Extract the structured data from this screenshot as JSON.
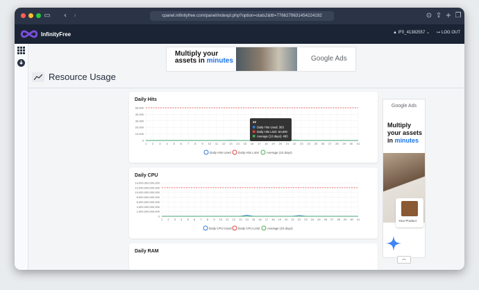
{
  "browser": {
    "url": "cpanel.infinityfree.com/panel/indexpl.php?option=stats2&ttt=7766279631454224192"
  },
  "app": {
    "brand": "InfinityFree",
    "user_label": "IF0_41382557",
    "logout_label": "LOG OUT"
  },
  "top_ad": {
    "line1": "Multiply your",
    "line2_prefix": "assets in ",
    "line2_highlight": "minutes",
    "brand": "Google Ads"
  },
  "page": {
    "title": "Resource Usage"
  },
  "side_ad": {
    "brand": "Google Ads",
    "line1": "Multiply",
    "line2": "your assets",
    "line3_prefix": "in ",
    "line3_highlight": "minutes",
    "product_label": "Your Product"
  },
  "colors": {
    "accent_blue": "#2f7bd9",
    "limit_red": "#e0413c",
    "average_green": "#4caf50",
    "brand_purple": "#6c3fd6",
    "appbar": "#1a2434"
  },
  "chart_data": [
    {
      "type": "line",
      "title": "Daily Hits",
      "x": [
        1,
        2,
        3,
        4,
        5,
        6,
        7,
        8,
        9,
        10,
        11,
        12,
        13,
        14,
        15,
        16,
        17,
        18,
        19,
        20,
        21,
        22,
        23,
        24,
        25,
        26,
        27,
        28,
        29,
        30,
        31
      ],
      "ylim": [
        0,
        50000
      ],
      "yticks": [
        "50,000",
        "40,000",
        "30,000",
        "20,000",
        "10,000",
        "0"
      ],
      "series": [
        {
          "name": "Daily Hits Used",
          "color": "#2f7bd9",
          "values": [
            0,
            0,
            0,
            0,
            0,
            0,
            0,
            0,
            0,
            0,
            0,
            0,
            363,
            0,
            0,
            0,
            0,
            0,
            0,
            0,
            0,
            363,
            0,
            0,
            0,
            0,
            0,
            0,
            0,
            0,
            0
          ]
        },
        {
          "name": "Daily Hits Limit",
          "color": "#e0413c",
          "values": [
            50000,
            50000,
            50000,
            50000,
            50000,
            50000,
            50000,
            50000,
            50000,
            50000,
            50000,
            50000,
            50000,
            50000,
            50000,
            50000,
            50000,
            50000,
            50000,
            50000,
            50000,
            50000,
            50000,
            50000,
            50000,
            50000,
            50000,
            50000,
            50000,
            50000,
            50000
          ]
        },
        {
          "name": "Average (10 days)",
          "color": "#4caf50",
          "values": [
            0,
            0,
            0,
            0,
            0,
            0,
            0,
            0,
            0,
            0,
            0,
            0,
            0,
            0,
            0,
            0,
            0,
            0,
            0,
            0,
            0,
            480,
            0,
            0,
            0,
            0,
            0,
            0,
            0,
            0,
            0
          ]
        }
      ],
      "tooltip": {
        "title": "22",
        "lines": [
          "Daily Hits Used: 363",
          "Daily Hits Limit: 50,000",
          "Average (10 days): 480"
        ]
      }
    },
    {
      "type": "line",
      "title": "Daily CPU",
      "x": [
        1,
        2,
        3,
        4,
        5,
        6,
        7,
        8,
        9,
        10,
        11,
        12,
        13,
        14,
        15,
        16,
        17,
        18,
        19,
        20,
        21,
        22,
        23,
        24,
        25,
        26,
        27,
        28,
        29,
        30,
        31
      ],
      "ylim": [
        0,
        14000000000000
      ],
      "yticks": [
        "14,000,000,000,000",
        "12,000,000,000,000",
        "10,000,000,000,000",
        "8,000,000,000,000",
        "6,000,000,000,000",
        "4,000,000,000,000",
        "2,000,000,000,000",
        "0"
      ],
      "series": [
        {
          "name": "Daily CPU Used",
          "color": "#2f7bd9",
          "values": [
            0,
            0,
            0,
            0,
            0,
            0,
            0,
            0,
            0,
            0,
            0,
            0,
            0,
            400000000000,
            0,
            0,
            0,
            0,
            0,
            0,
            0,
            300000000000,
            0,
            0,
            0,
            0,
            0,
            0,
            0,
            0,
            0
          ]
        },
        {
          "name": "Daily CPU Limit",
          "color": "#e0413c",
          "values": [
            12000000000000,
            12000000000000,
            12000000000000,
            12000000000000,
            12000000000000,
            12000000000000,
            12000000000000,
            12000000000000,
            12000000000000,
            12000000000000,
            12000000000000,
            12000000000000,
            12000000000000,
            12000000000000,
            12000000000000,
            12000000000000,
            12000000000000,
            12000000000000,
            12000000000000,
            12000000000000,
            12000000000000,
            12000000000000,
            12000000000000,
            12000000000000,
            12000000000000,
            12000000000000,
            12000000000000,
            12000000000000,
            12000000000000,
            12000000000000,
            12000000000000
          ]
        },
        {
          "name": "Average (10 days)",
          "color": "#4caf50",
          "values": [
            0,
            0,
            0,
            0,
            0,
            0,
            0,
            0,
            0,
            0,
            0,
            0,
            0,
            0,
            0,
            0,
            0,
            0,
            0,
            0,
            0,
            0,
            0,
            0,
            0,
            0,
            0,
            0,
            0,
            0,
            0
          ]
        }
      ]
    },
    {
      "type": "line",
      "title": "Daily RAM"
    }
  ]
}
